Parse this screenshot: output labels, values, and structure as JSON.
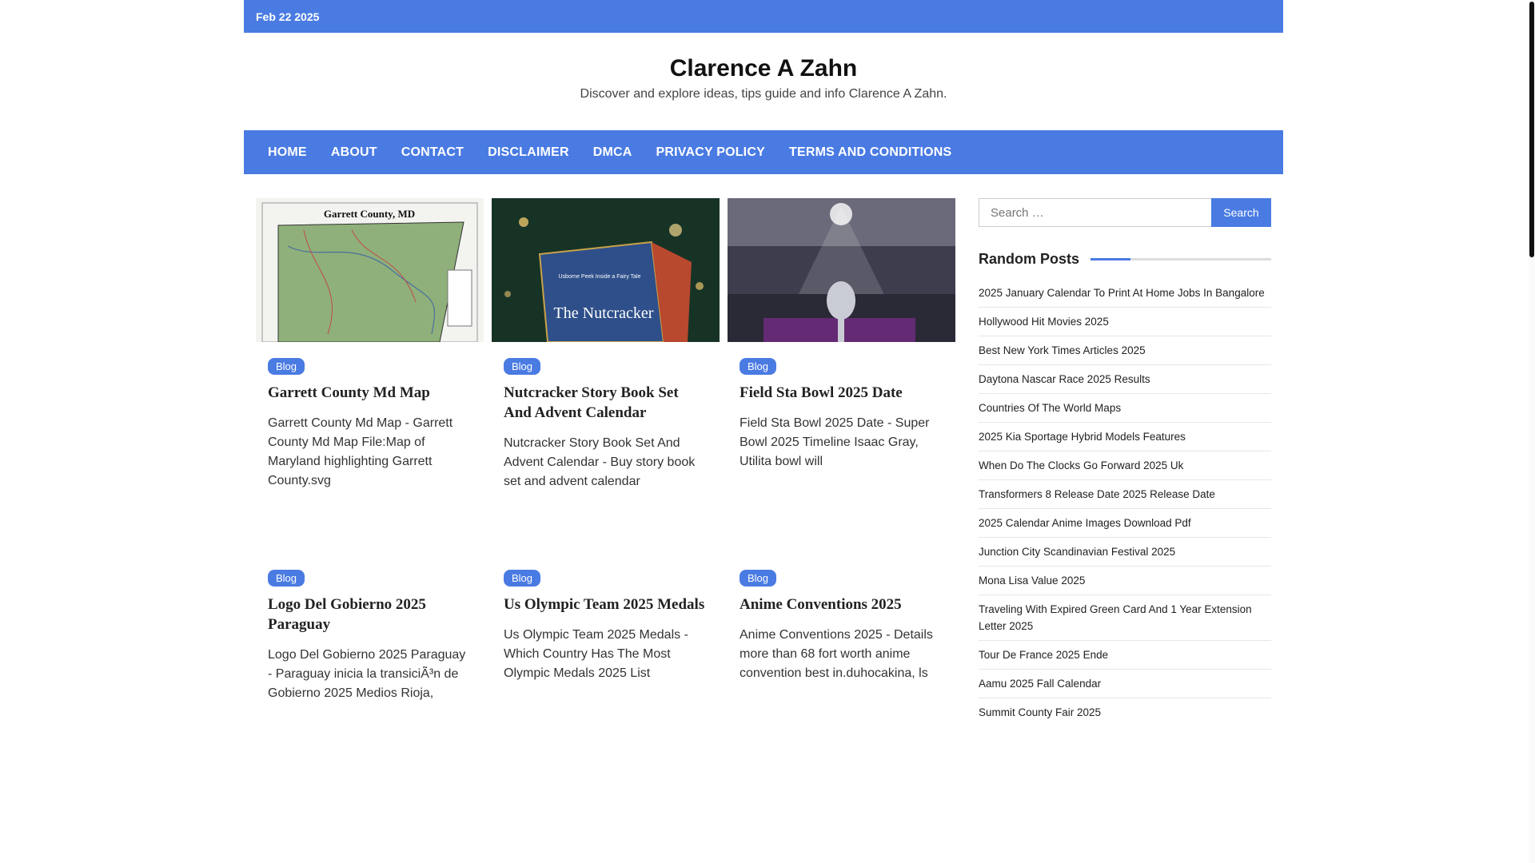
{
  "topbar": {
    "date": "Feb 22 2025"
  },
  "header": {
    "title": "Clarence A Zahn",
    "description": "Discover and explore ideas, tips guide and info Clarence A Zahn."
  },
  "nav": [
    "HOME",
    "ABOUT",
    "CONTACT",
    "DISCLAIMER",
    "DMCA",
    "PRIVACY POLICY",
    "TERMS AND CONDITIONS"
  ],
  "posts": [
    {
      "category": "Blog",
      "title": "Garrett County Md Map",
      "excerpt": "Garrett County Md Map - Garrett County Md Map File:Map of Maryland highlighting Garrett County.svg",
      "image_caption": "Garrett County, MD",
      "image": "map-thumbnail"
    },
    {
      "category": "Blog",
      "title": "Nutcracker Story Book Set And Advent Calendar",
      "excerpt": "Nutcracker Story Book Set And Advent Calendar - Buy story book set and advent calendar",
      "image_caption": "The Nutcracker",
      "image_subcaption": "Usborne Peek Inside a Fairy Tale",
      "image": "book-thumbnail"
    },
    {
      "category": "Blog",
      "title": "Field Sta Bowl 2025 Date",
      "excerpt": "Field Sta Bowl 2025 Date - Super Bowl 2025 Timeline Isaac Gray, Utilita bowl will",
      "image": "stadium-thumbnail"
    },
    {
      "category": "Blog",
      "title": "Logo Del Gobierno 2025 Paraguay",
      "excerpt": "Logo Del Gobierno 2025 Paraguay - Paraguay inicia la transiciÃ³n de Gobierno 2025 Medios Rioja,"
    },
    {
      "category": "Blog",
      "title": "Us Olympic Team 2025 Medals",
      "excerpt": "Us Olympic Team 2025 Medals - Which Country Has The Most Olympic Medals 2025 List"
    },
    {
      "category": "Blog",
      "title": "Anime Conventions 2025",
      "excerpt": "Anime Conventions 2025 - Details more than 68 fort worth anime convention best in.duhocakina, ls"
    }
  ],
  "sidebar": {
    "search": {
      "placeholder": "Search …",
      "button": "Search"
    },
    "random_title": "Random Posts",
    "random_posts": [
      "2025 January Calendar To Print At Home Jobs In Bangalore",
      "Hollywood Hit Movies 2025",
      "Best New York Times Articles 2025",
      "Daytona Nascar Race 2025 Results",
      "Countries Of The World Maps",
      "2025 Kia Sportage Hybrid Models Features",
      "When Do The Clocks Go Forward 2025 Uk",
      "Transformers 8 Release Date 2025 Release Date",
      "2025 Calendar Anime Images Download Pdf",
      "Junction City Scandinavian Festival 2025",
      "Mona Lisa Value 2025",
      "Traveling With Expired Green Card And 1 Year Extension Letter 2025",
      "Tour De France 2025 Ende",
      "Aamu 2025 Fall Calendar",
      "Summit County Fair 2025"
    ]
  },
  "colors": {
    "accent": "#4a7be3"
  }
}
